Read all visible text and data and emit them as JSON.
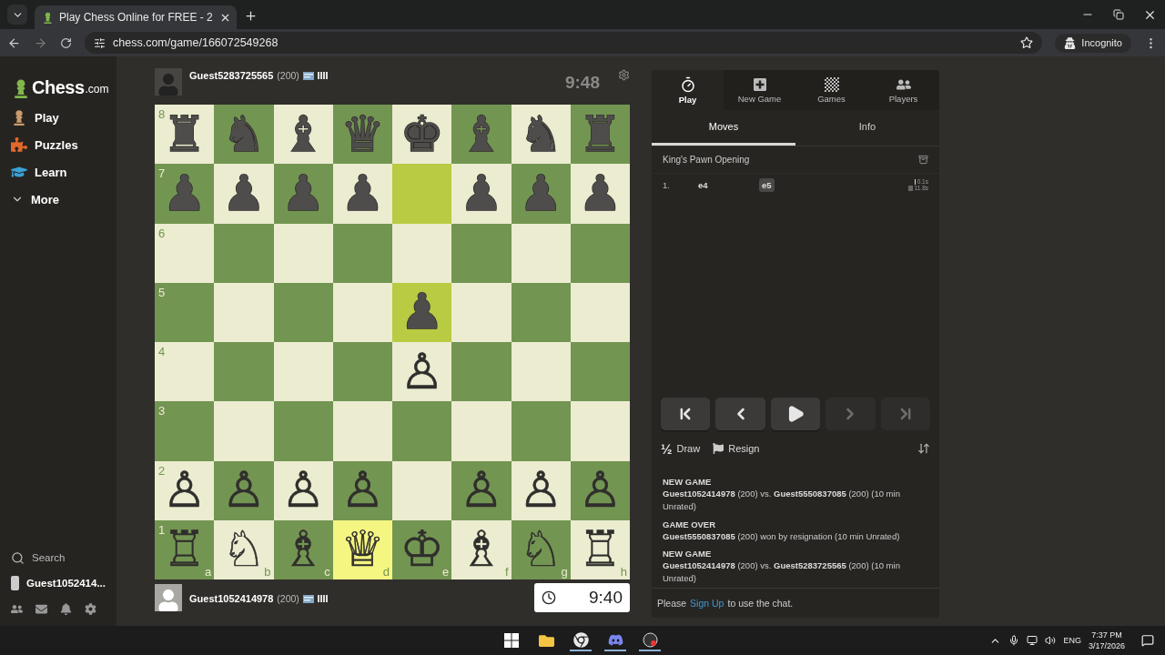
{
  "browser": {
    "tab_title": "Play Chess Online for FREE - 2",
    "url": "chess.com/game/166072549268",
    "profile_label": "Incognito"
  },
  "sidebar": {
    "logo": {
      "name": "Chess",
      "suffix": ".com"
    },
    "items": [
      {
        "label": "Play"
      },
      {
        "label": "Puzzles"
      },
      {
        "label": "Learn"
      },
      {
        "label": "More"
      }
    ],
    "search_label": "Search",
    "user_label": "Guest1052414..."
  },
  "game": {
    "top_player": {
      "name": "Guest5283725565",
      "rating": "(200)",
      "clock": "9:48",
      "active": false
    },
    "bottom_player": {
      "name": "Guest1052414978",
      "rating": "(200)",
      "clock": "9:40",
      "active": true
    },
    "board": {
      "files": [
        "a",
        "b",
        "c",
        "d",
        "e",
        "f",
        "g",
        "h"
      ],
      "ranks": [
        {
          "label": "8",
          "squares": [
            {
              "piece": "♜",
              "white": false,
              "highlighted": false
            },
            {
              "piece": "♞",
              "white": false,
              "highlighted": false
            },
            {
              "piece": "♝",
              "white": false,
              "highlighted": false
            },
            {
              "piece": "♛",
              "white": false,
              "highlighted": false
            },
            {
              "piece": "♚",
              "white": false,
              "highlighted": false
            },
            {
              "piece": "♝",
              "white": false,
              "highlighted": false
            },
            {
              "piece": "♞",
              "white": false,
              "highlighted": false
            },
            {
              "piece": "♜",
              "white": false,
              "highlighted": false
            }
          ]
        },
        {
          "label": "7",
          "squares": [
            {
              "piece": "♟",
              "white": false,
              "highlighted": false
            },
            {
              "piece": "♟",
              "white": false,
              "highlighted": false
            },
            {
              "piece": "♟",
              "white": false,
              "highlighted": false
            },
            {
              "piece": "♟",
              "white": false,
              "highlighted": false
            },
            {
              "highlighted": true
            },
            {
              "piece": "♟",
              "white": false,
              "highlighted": false
            },
            {
              "piece": "♟",
              "white": false,
              "highlighted": false
            },
            {
              "piece": "♟",
              "white": false,
              "highlighted": false
            }
          ]
        },
        {
          "label": "6",
          "squares": [
            {
              "highlighted": false
            },
            {
              "highlighted": false
            },
            {
              "highlighted": false
            },
            {
              "highlighted": false
            },
            {
              "highlighted": false
            },
            {
              "highlighted": false
            },
            {
              "highlighted": false
            },
            {
              "highlighted": false
            }
          ]
        },
        {
          "label": "5",
          "squares": [
            {
              "highlighted": false
            },
            {
              "highlighted": false
            },
            {
              "highlighted": false
            },
            {
              "highlighted": false
            },
            {
              "piece": "♟",
              "white": false,
              "highlighted": true
            },
            {
              "highlighted": false
            },
            {
              "highlighted": false
            },
            {
              "highlighted": false
            }
          ]
        },
        {
          "label": "4",
          "squares": [
            {
              "highlighted": false
            },
            {
              "highlighted": false
            },
            {
              "highlighted": false
            },
            {
              "highlighted": false
            },
            {
              "piece": "♙",
              "white": true,
              "highlighted": false
            },
            {
              "highlighted": false
            },
            {
              "highlighted": false
            },
            {
              "highlighted": false
            }
          ]
        },
        {
          "label": "3",
          "squares": [
            {
              "highlighted": false
            },
            {
              "highlighted": false
            },
            {
              "highlighted": false
            },
            {
              "highlighted": false
            },
            {
              "highlighted": false
            },
            {
              "highlighted": false
            },
            {
              "highlighted": false
            },
            {
              "highlighted": false
            }
          ]
        },
        {
          "label": "2",
          "squares": [
            {
              "piece": "♙",
              "white": true,
              "highlighted": false
            },
            {
              "piece": "♙",
              "white": true,
              "highlighted": false
            },
            {
              "piece": "♙",
              "white": true,
              "highlighted": false
            },
            {
              "piece": "♙",
              "white": true,
              "highlighted": false
            },
            {
              "highlighted": false
            },
            {
              "piece": "♙",
              "white": true,
              "highlighted": false
            },
            {
              "piece": "♙",
              "white": true,
              "highlighted": false
            },
            {
              "piece": "♙",
              "white": true,
              "highlighted": false
            }
          ]
        },
        {
          "label": "1",
          "squares": [
            {
              "piece": "♖",
              "white": true,
              "highlighted": false
            },
            {
              "piece": "♘",
              "white": true,
              "highlighted": false
            },
            {
              "piece": "♗",
              "white": true,
              "highlighted": false
            },
            {
              "piece": "♕",
              "white": true,
              "highlighted": true
            },
            {
              "piece": "♔",
              "white": true,
              "highlighted": false
            },
            {
              "piece": "♗",
              "white": true,
              "highlighted": false
            },
            {
              "piece": "♘",
              "white": true,
              "highlighted": false
            },
            {
              "piece": "♖",
              "white": true,
              "highlighted": false
            }
          ]
        }
      ]
    }
  },
  "panel": {
    "nav": [
      {
        "label": "Play",
        "selected": true
      },
      {
        "label": "New Game",
        "selected": false
      },
      {
        "label": "Games",
        "selected": false
      },
      {
        "label": "Players",
        "selected": false
      }
    ],
    "tabs": [
      {
        "label": "Moves",
        "selected": true
      },
      {
        "label": "Info",
        "selected": false
      }
    ],
    "opening": "King's Pawn Opening",
    "moves": [
      {
        "number": "1.",
        "white": {
          "san": "e4",
          "selected": false,
          "time": "0.1s"
        },
        "black": {
          "san": "e5",
          "selected": true,
          "time": "11.8s"
        }
      }
    ],
    "controls": [
      {
        "enabled": true
      },
      {
        "enabled": true
      },
      {
        "enabled": true
      },
      {
        "enabled": false
      },
      {
        "enabled": false
      }
    ],
    "draw_symbol": "½",
    "draw_label": "Draw",
    "resign_label": "Resign",
    "chat_log": [
      {
        "title": "NEW GAME",
        "body": "**Guest1052414978** (200) vs. **Guest5550837085** (200) (10 min Unrated)"
      },
      {
        "title": "GAME OVER",
        "body": "**Guest5550837085** (200) won by resignation (10 min Unrated)"
      },
      {
        "title": "NEW GAME",
        "body": "**Guest1052414978** (200) vs. **Guest5283725565** (200) (10 min Unrated)"
      }
    ],
    "chat_prompt": {
      "before": "Please",
      "link": "Sign Up",
      "after": "to use the chat."
    }
  },
  "taskbar": {
    "language": "ENG",
    "time": "7:37 PM",
    "date": "3/17/2026"
  }
}
